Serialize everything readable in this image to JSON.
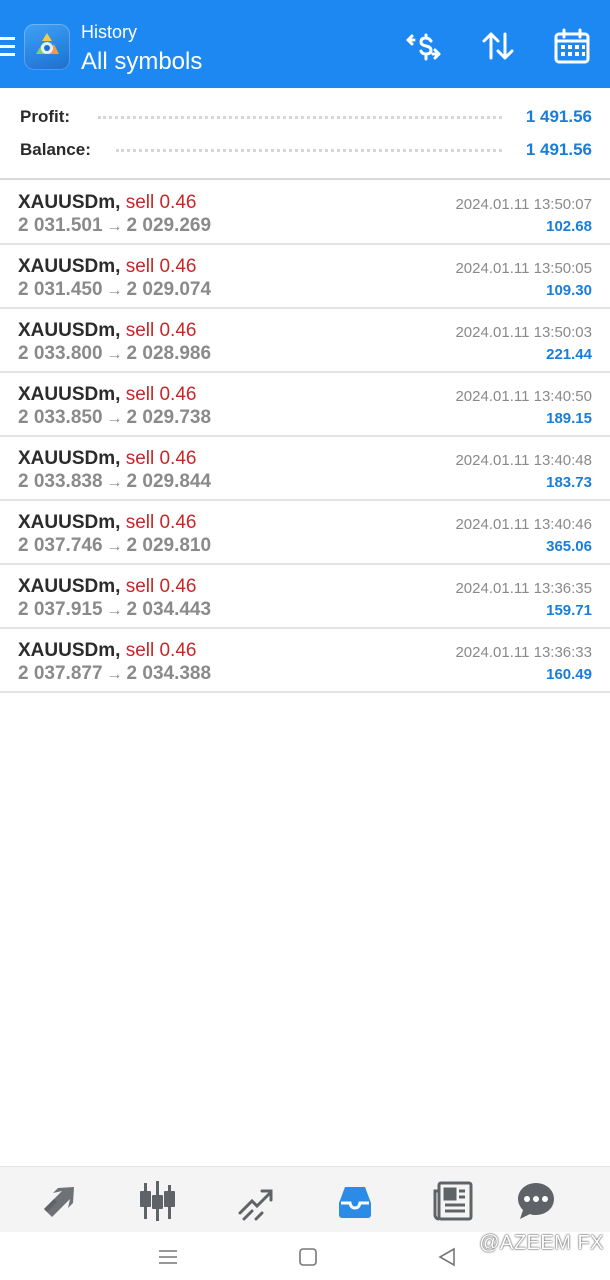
{
  "header": {
    "subtitle": "History",
    "title": "All symbols",
    "accent": "#1e88f2"
  },
  "summary": {
    "profit_label": "Profit:",
    "profit_value": "1 491.56",
    "balance_label": "Balance:",
    "balance_value": "1 491.56"
  },
  "deals": [
    {
      "symbol": "XAUUSDm",
      "side": "sell 0.46",
      "open": "2 031.501",
      "close": "2 029.269",
      "time": "2024.01.11 13:50:07",
      "profit": "102.68"
    },
    {
      "symbol": "XAUUSDm",
      "side": "sell 0.46",
      "open": "2 031.450",
      "close": "2 029.074",
      "time": "2024.01.11 13:50:05",
      "profit": "109.30"
    },
    {
      "symbol": "XAUUSDm",
      "side": "sell 0.46",
      "open": "2 033.800",
      "close": "2 028.986",
      "time": "2024.01.11 13:50:03",
      "profit": "221.44"
    },
    {
      "symbol": "XAUUSDm",
      "side": "sell 0.46",
      "open": "2 033.850",
      "close": "2 029.738",
      "time": "2024.01.11 13:40:50",
      "profit": "189.15"
    },
    {
      "symbol": "XAUUSDm",
      "side": "sell 0.46",
      "open": "2 033.838",
      "close": "2 029.844",
      "time": "2024.01.11 13:40:48",
      "profit": "183.73"
    },
    {
      "symbol": "XAUUSDm",
      "side": "sell 0.46",
      "open": "2 037.746",
      "close": "2 029.810",
      "time": "2024.01.11 13:40:46",
      "profit": "365.06"
    },
    {
      "symbol": "XAUUSDm",
      "side": "sell 0.46",
      "open": "2 037.915",
      "close": "2 034.443",
      "time": "2024.01.11 13:36:35",
      "profit": "159.71"
    },
    {
      "symbol": "XAUUSDm",
      "side": "sell 0.46",
      "open": "2 037.877",
      "close": "2 034.388",
      "time": "2024.01.11 13:36:33",
      "profit": "160.49"
    }
  ],
  "deal_separator": ",",
  "deal_arrow": "→",
  "bottom_nav": {
    "items": [
      "quotes-icon",
      "chart-icon",
      "trade-icon",
      "history-icon",
      "news-icon",
      "messages-icon"
    ],
    "active": "history-icon",
    "active_color": "#2b8be6"
  },
  "header_icons": [
    "currency-exchange-icon",
    "sort-icon",
    "calendar-icon"
  ],
  "system_nav": [
    "recent-apps-icon",
    "home-icon",
    "back-icon"
  ],
  "watermark": "@AZEEM FX",
  "colors": {
    "sell": "#c62828",
    "profit": "#1a7ed8",
    "muted": "#8a8a8a"
  }
}
